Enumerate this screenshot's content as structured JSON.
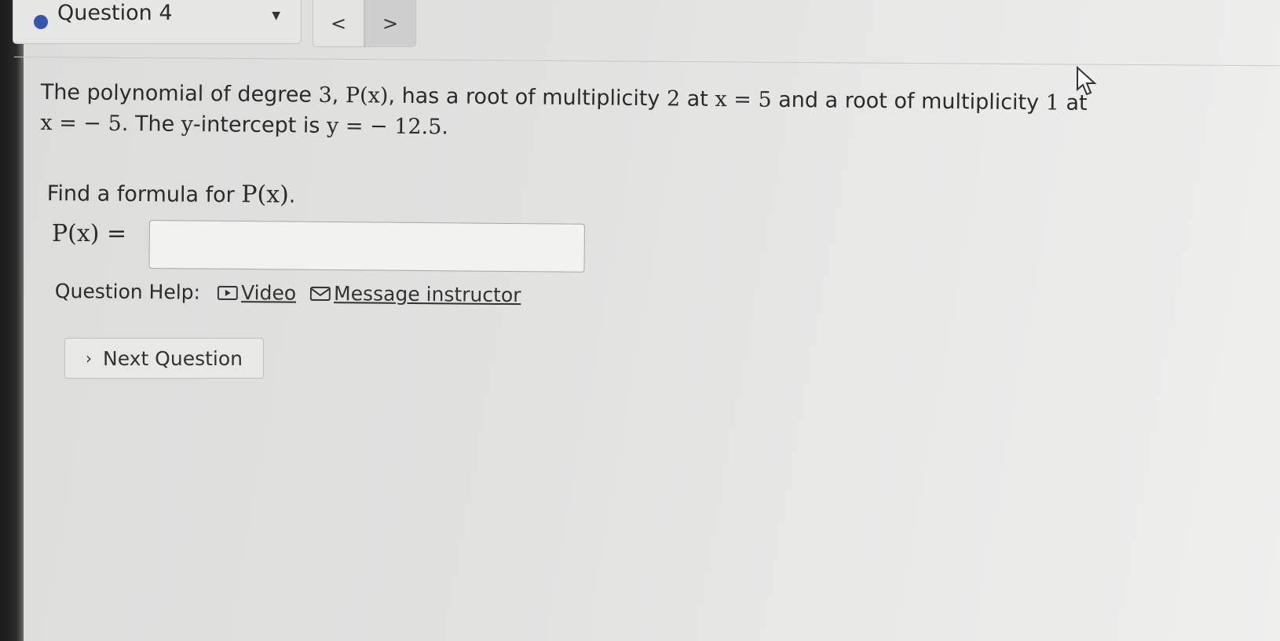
{
  "question_nav": {
    "title": "Question 4",
    "dropdown_icon": "caret-down-icon",
    "prev_label": "<",
    "next_label": ">"
  },
  "problem": {
    "part1": "The polynomial of degree ",
    "degree": "3",
    "comma": ", ",
    "func": "P(x)",
    "part2": ", has a root of multiplicity ",
    "mult1": "2",
    "part3": " at ",
    "root1": "x = 5",
    "part4": " and a root of multiplicity ",
    "mult2": "1",
    "part5": " at ",
    "root2": "x = − 5",
    "part6": ". The ",
    "yvar": "y",
    "part7": "-intercept is ",
    "intercept": "y = − 12.5",
    "part8": "."
  },
  "find": {
    "prompt": "Find a formula for ",
    "func": "P(x)",
    "period": "."
  },
  "answer": {
    "label": "P(x) =",
    "value": "",
    "placeholder": ""
  },
  "help": {
    "label": "Question Help:",
    "video_label": "Video",
    "message_label": "Message instructor"
  },
  "next_question_label": "Next Question",
  "colors": {
    "status_dot": "#3853b3"
  }
}
